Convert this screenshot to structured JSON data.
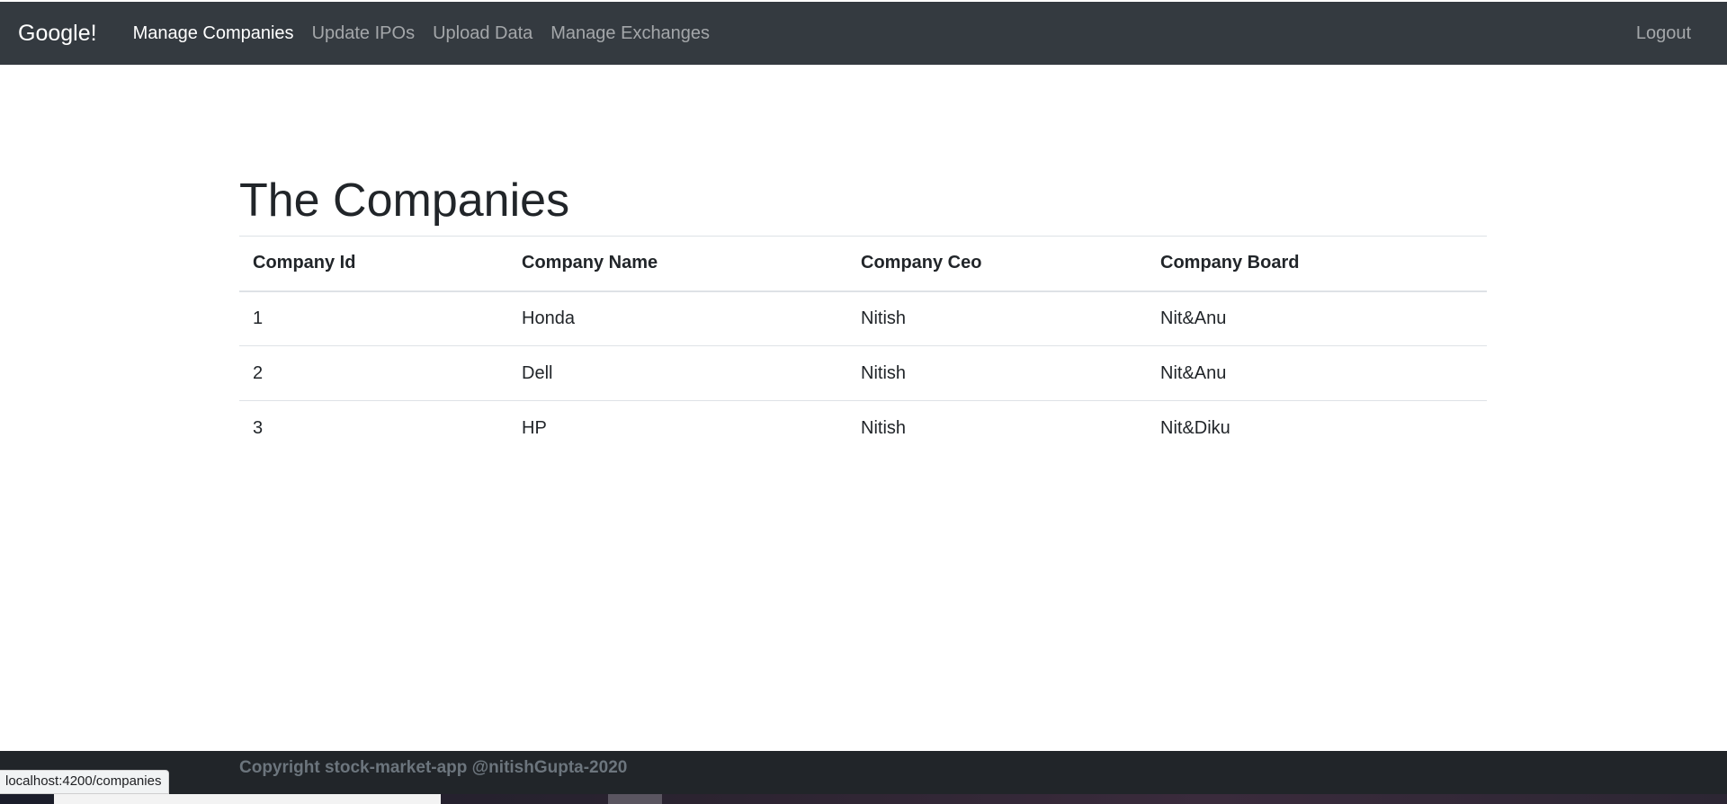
{
  "nav": {
    "brand": "Google!",
    "links": [
      {
        "label": "Manage Companies",
        "active": true
      },
      {
        "label": "Update IPOs",
        "active": false
      },
      {
        "label": "Upload Data",
        "active": false
      },
      {
        "label": "Manage Exchanges",
        "active": false
      }
    ],
    "logout": "Logout"
  },
  "main": {
    "title": "The Companies",
    "table": {
      "headers": [
        "Company Id",
        "Company Name",
        "Company Ceo",
        "Company Board"
      ],
      "rows": [
        [
          "1",
          "Honda",
          "Nitish",
          "Nit&Anu"
        ],
        [
          "2",
          "Dell",
          "Nitish",
          "Nit&Anu"
        ],
        [
          "3",
          "HP",
          "Nitish",
          "Nit&Diku"
        ]
      ]
    }
  },
  "footer": {
    "text": "Copyright stock-market-app @nitishGupta-2020"
  },
  "status_bar": {
    "url": "localhost:4200/companies"
  }
}
